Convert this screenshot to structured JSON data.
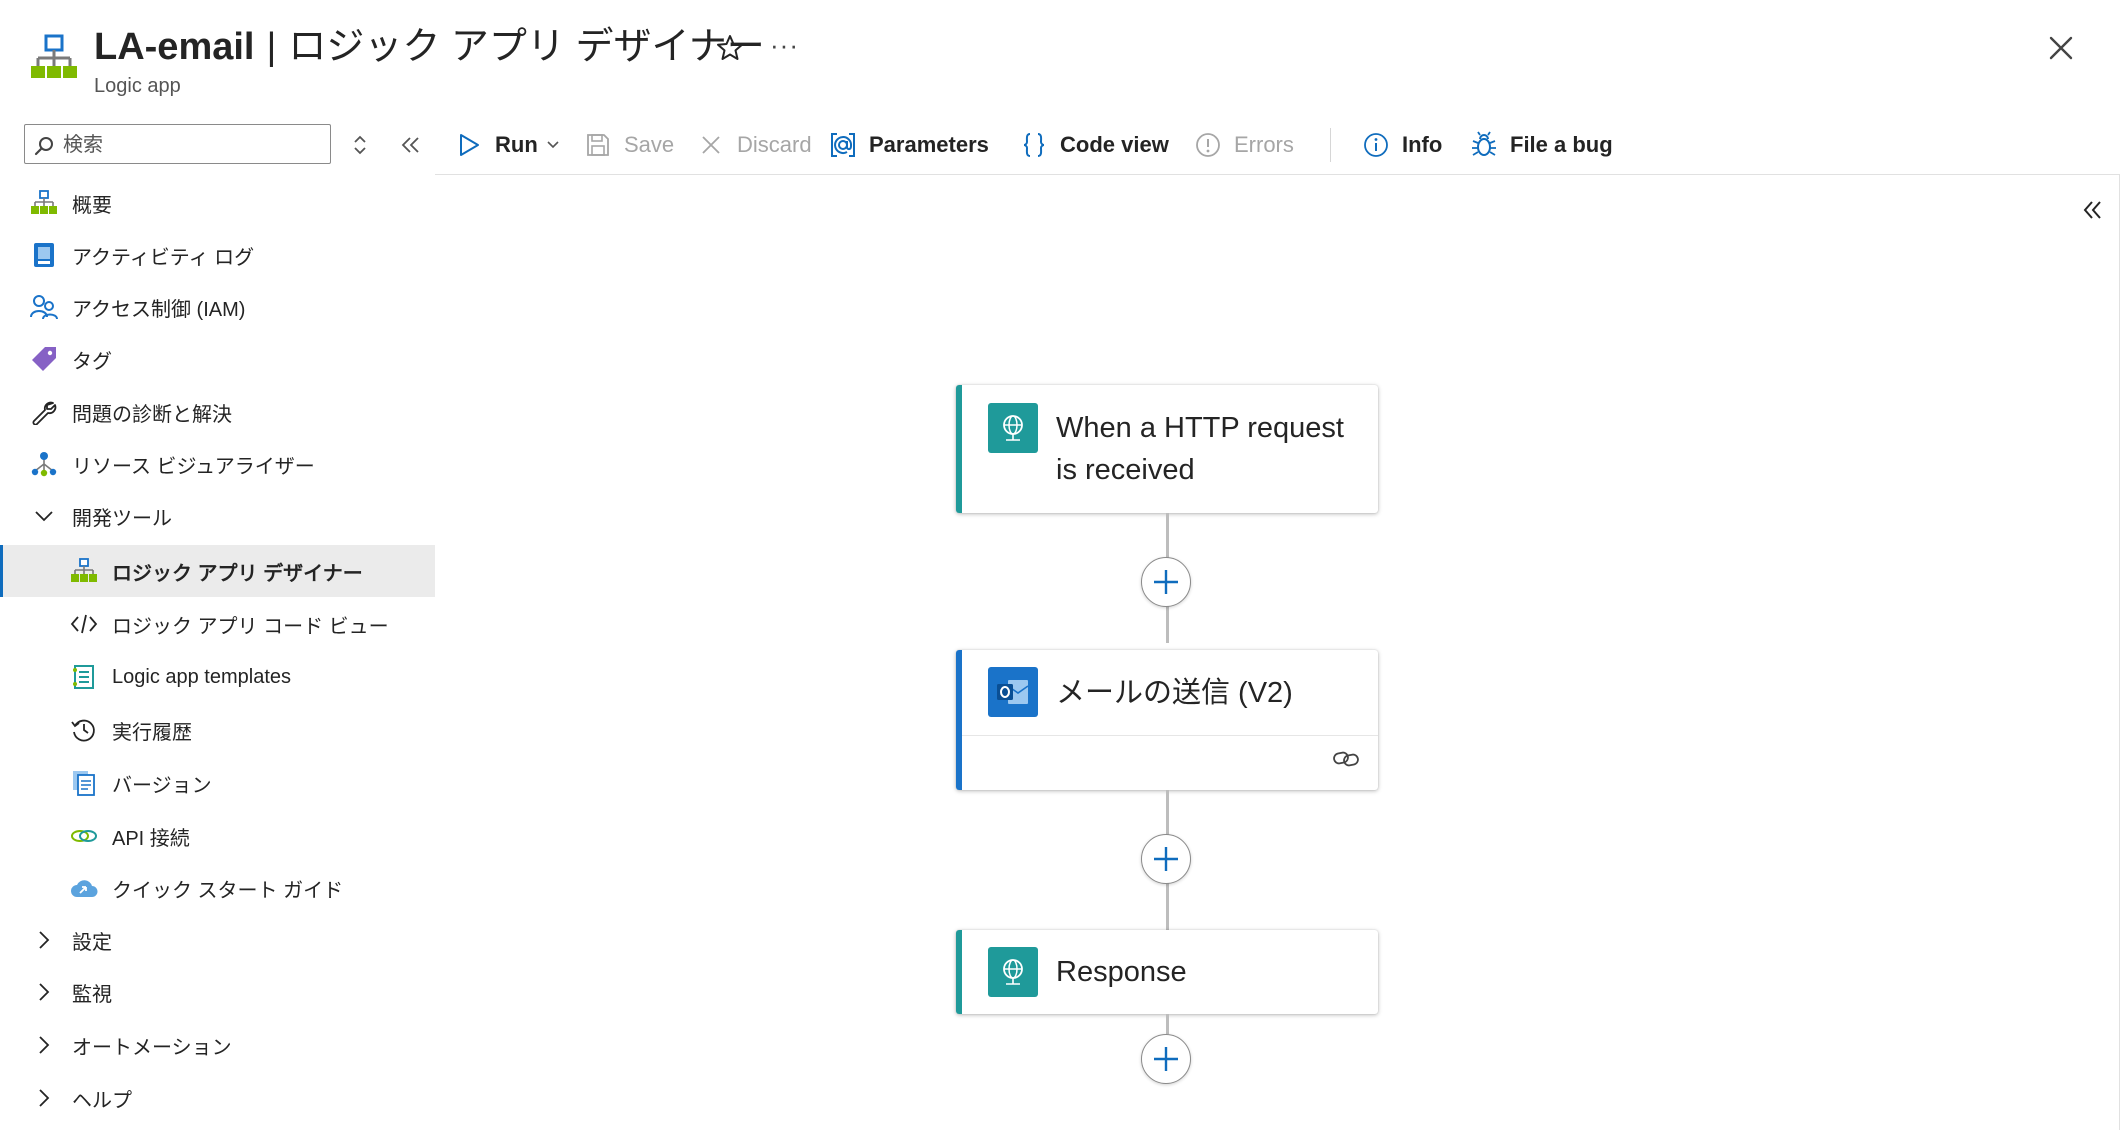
{
  "header": {
    "resource_name": "LA-email",
    "separator": "|",
    "page_name": "ロジック アプリ デザイナー",
    "subtitle": "Logic app",
    "more_label": "···"
  },
  "sidebar": {
    "search_placeholder": "検索",
    "items": [
      {
        "label": "概要",
        "icon": "logic-app-icon"
      },
      {
        "label": "アクティビティ ログ",
        "icon": "activity-log-icon"
      },
      {
        "label": "アクセス制御 (IAM)",
        "icon": "people-icon"
      },
      {
        "label": "タグ",
        "icon": "tag-icon"
      },
      {
        "label": "問題の診断と解決",
        "icon": "wrench-icon"
      },
      {
        "label": "リソース ビジュアライザー",
        "icon": "hierarchy-icon"
      },
      {
        "label": "開発ツール",
        "icon": "chevron-down-icon",
        "expanded": true
      },
      {
        "label": "ロジック アプリ デザイナー",
        "icon": "logic-app-icon",
        "active": true
      },
      {
        "label": "ロジック アプリ コード ビュー",
        "icon": "code-icon"
      },
      {
        "label": "Logic app templates",
        "icon": "templates-icon"
      },
      {
        "label": "実行履歴",
        "icon": "history-icon"
      },
      {
        "label": "バージョン",
        "icon": "versions-icon"
      },
      {
        "label": "API 接続",
        "icon": "link-icon"
      },
      {
        "label": "クイック スタート ガイド",
        "icon": "cloud-icon"
      },
      {
        "label": "設定",
        "icon": "chevron-right-icon"
      },
      {
        "label": "監視",
        "icon": "chevron-right-icon"
      },
      {
        "label": "オートメーション",
        "icon": "chevron-right-icon"
      },
      {
        "label": "ヘルプ",
        "icon": "chevron-right-icon"
      }
    ]
  },
  "toolbar": {
    "run": "Run",
    "save": "Save",
    "discard": "Discard",
    "parameters": "Parameters",
    "code_view": "Code view",
    "errors": "Errors",
    "info": "Info",
    "file_bug": "File a bug"
  },
  "workflow": {
    "trigger_title_line1": "When a HTTP request",
    "trigger_title_line2": "is received",
    "email_title": "メールの送信 (V2)",
    "response_title": "Response"
  },
  "colors": {
    "accent": "#0f6cbd",
    "http_teal": "#1f9a9a",
    "outlook_blue": "#1a73c9"
  }
}
